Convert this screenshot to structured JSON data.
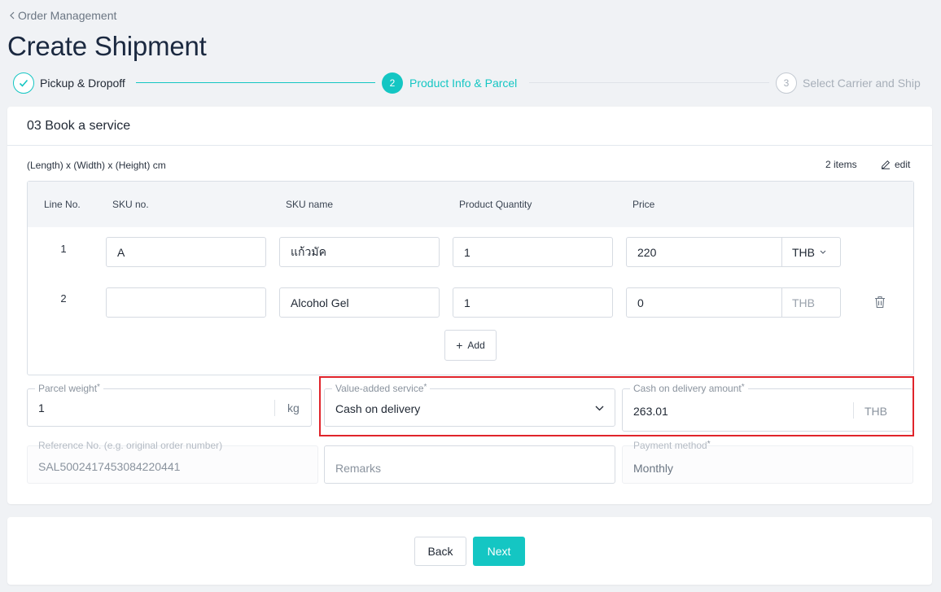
{
  "breadcrumb": {
    "label": "Order Management"
  },
  "page": {
    "title": "Create Shipment"
  },
  "stepper": {
    "steps": [
      {
        "number": "",
        "label": "Pickup & Dropoff",
        "state": "done"
      },
      {
        "number": "2",
        "label": "Product Info & Parcel",
        "state": "active"
      },
      {
        "number": "3",
        "label": "Select Carrier and Ship",
        "state": "pending"
      }
    ]
  },
  "section": {
    "title": "03 Book a service",
    "dims_label": "(Length) x (Width) x (Height) cm",
    "items_count": "2 items",
    "edit_label": "edit"
  },
  "table": {
    "headers": [
      "Line No.",
      "SKU no.",
      "SKU name",
      "Product Quantity",
      "Price"
    ],
    "rows": [
      {
        "line": "1",
        "sku_no": "A",
        "sku_name": "แก้วมัค",
        "quantity": "1",
        "price": "220",
        "currency": "THB"
      },
      {
        "line": "2",
        "sku_no": "",
        "sku_name": "Alcohol Gel",
        "quantity": "1",
        "price": "0",
        "currency": "THB"
      }
    ],
    "add_label": "Add"
  },
  "parcel": {
    "weight_label": "Parcel weight",
    "weight_value": "1",
    "weight_unit": "kg",
    "vas_label": "Value-added service",
    "vas_value": "Cash on delivery",
    "cod_label": "Cash on delivery amount",
    "cod_value": "263.01",
    "cod_currency": "THB",
    "ref_label": "Reference No. (e.g. original order number)",
    "ref_value": "SAL5002417453084220441",
    "remarks_placeholder": "Remarks",
    "payment_label": "Payment method",
    "payment_value": "Monthly",
    "required_mark": "*"
  },
  "footer": {
    "back_label": "Back",
    "next_label": "Next"
  },
  "colors": {
    "accent": "#14c6c3",
    "highlight": "#e0242b",
    "title": "#1b2940"
  }
}
